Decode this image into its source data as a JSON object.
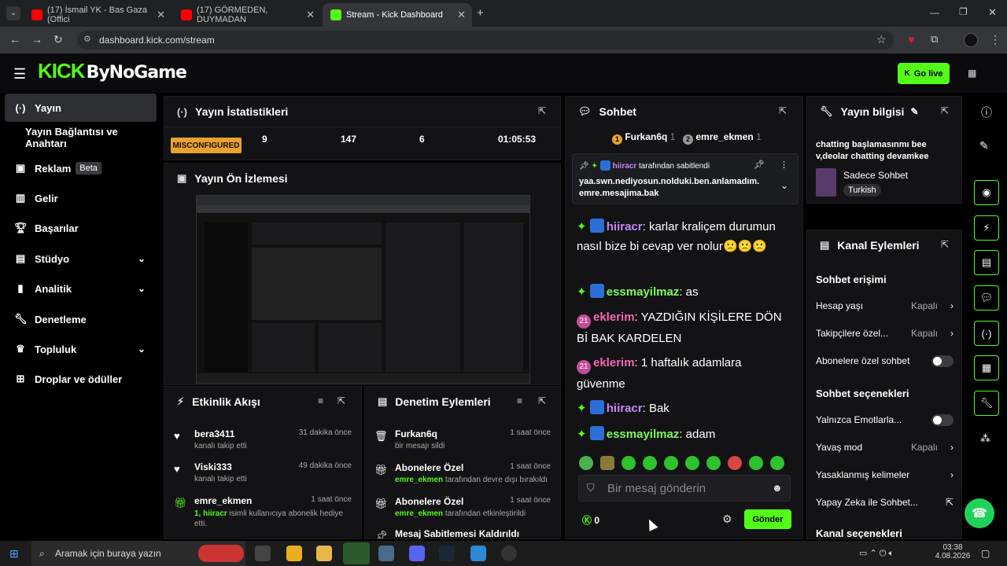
{
  "browser": {
    "tabs": [
      {
        "label": "(17) İsmail YK - Bas Gaza (Offici"
      },
      {
        "label": "(17) GÖRMEDEN, DUYMADAN"
      },
      {
        "label": "Stream - Kick Dashboard"
      }
    ],
    "url": "dashboard.kick.com/stream"
  },
  "header": {
    "logo": "ByNoGame",
    "go_live": "Go live"
  },
  "sidebar": {
    "items": [
      {
        "label": "Yayın"
      },
      {
        "label": "Yayın Bağlantısı ve Anahtarı"
      },
      {
        "label": "Reklam",
        "badge": "Beta"
      },
      {
        "label": "Gelir"
      },
      {
        "label": "Başarılar"
      },
      {
        "label": "Stüdyo"
      },
      {
        "label": "Analitik"
      },
      {
        "label": "Denetleme"
      },
      {
        "label": "Topluluk"
      },
      {
        "label": "Droplar ve ödüller"
      }
    ]
  },
  "stats": {
    "title": "Yayın İstatistikleri",
    "status": "MISCONFIGURED",
    "v1": "9",
    "v2": "147",
    "v3": "6",
    "duration": "01:05:53"
  },
  "preview": {
    "title": "Yayın Ön İzlemesi"
  },
  "activity": {
    "title": "Etkinlik Akışı",
    "items": [
      {
        "name": "bera3411",
        "sub": "kanalı takip etti",
        "time": "31 dakika önce"
      },
      {
        "name": "Viski333",
        "sub": "kanalı takip etti",
        "time": "49 dakika önce"
      },
      {
        "name": "emre_ekmen",
        "sub_a": "1, hiiracr",
        "sub_b": " isimli kullanıcıya abonelik hediye etti.",
        "time": "1 saat önce"
      }
    ]
  },
  "moderation": {
    "title": "Denetim Eylemleri",
    "items": [
      {
        "name": "Furkan6q",
        "sub": "bir mesajı sildi",
        "time": "1 saat önce"
      },
      {
        "name": "Abonelere Özel",
        "sub_a": "emre_ekmen",
        "sub_b": " tarafından devre dışı bırakıldı",
        "time": "1 saat önce"
      },
      {
        "name": "Abonelere Özel",
        "sub_a": "emre_ekmen",
        "sub_b": " tarafından etkinleştirildi",
        "time": "1 saat önce"
      },
      {
        "name": "Mesaj Sabitlemesi Kaldırıldı"
      }
    ]
  },
  "chat": {
    "title": "Sohbet",
    "top_users": [
      {
        "name": "Furkan6q",
        "count": "1"
      },
      {
        "name": "emre_ekmen",
        "count": "1"
      }
    ],
    "pinned": {
      "by_user": "hiiracr",
      "by_text": " tarafından sabitlendi",
      "text": "yaa.swn.nediyosun.nolduki.ben.anlamadım.emre.mesajima.bak"
    },
    "messages": [
      {
        "user": "hiiracr",
        "text": ": karlar kraliçem durumun nasıl bize bi cevap ver nolur",
        "tail": "🙁🙁🙁",
        "cls": "u-hiir",
        "badges": "gk"
      },
      {
        "user": "essmayilmaz",
        "text": ": as",
        "cls": "u-essm",
        "badges": "gk"
      },
      {
        "user": "eklerim",
        "text": ": YAZDIĞIN KİŞİLERE DÖN Bİ BAK KARDELEN",
        "cls": "u-ekl",
        "badges": "p"
      },
      {
        "user": "eklerim",
        "text": ": 1 haftalık adamlara güvenme",
        "cls": "u-ekl",
        "badges": "p"
      },
      {
        "user": "hiiracr",
        "text": ": Bak",
        "cls": "u-hiir",
        "badges": "gk"
      },
      {
        "user": "essmayilmaz",
        "text": ": adam",
        "cls": "u-essm",
        "badges": "gk"
      }
    ],
    "sub_badge": "21",
    "input_placeholder": "Bir mesaj gönderin",
    "points": "0",
    "send": "Gönder"
  },
  "stream_info": {
    "title": "Yayın bilgisi",
    "stream_title": "chatting başlamasınmı bee v,deolar chatting devamkee",
    "category": "Sadece Sohbet",
    "tag": "Turkish"
  },
  "channel_actions": {
    "title": "Kanal Eylemleri",
    "sect1": "Sohbet erişimi",
    "rows1": [
      {
        "label": "Hesap yaşı",
        "value": "Kapalı"
      },
      {
        "label": "Takipçilere özel...",
        "value": "Kapalı"
      },
      {
        "label": "Abonelere özel sohbet"
      }
    ],
    "sect2": "Sohbet seçenekleri",
    "rows2": [
      {
        "label": "Yalnızca Emotlarla..."
      },
      {
        "label": "Yavaş mod",
        "value": "Kapalı"
      },
      {
        "label": "Yasaklanmış kelimeler"
      },
      {
        "label": "Yapay Zeka ile Sohbet..."
      }
    ],
    "sect3": "Kanal seçenekleri"
  },
  "taskbar": {
    "search": "Aramak için buraya yazın",
    "time": "03:38",
    "date": "4.08.2026"
  },
  "colors": {
    "accent": "#53fc18",
    "bg": "#000000",
    "panel": "#131315"
  }
}
